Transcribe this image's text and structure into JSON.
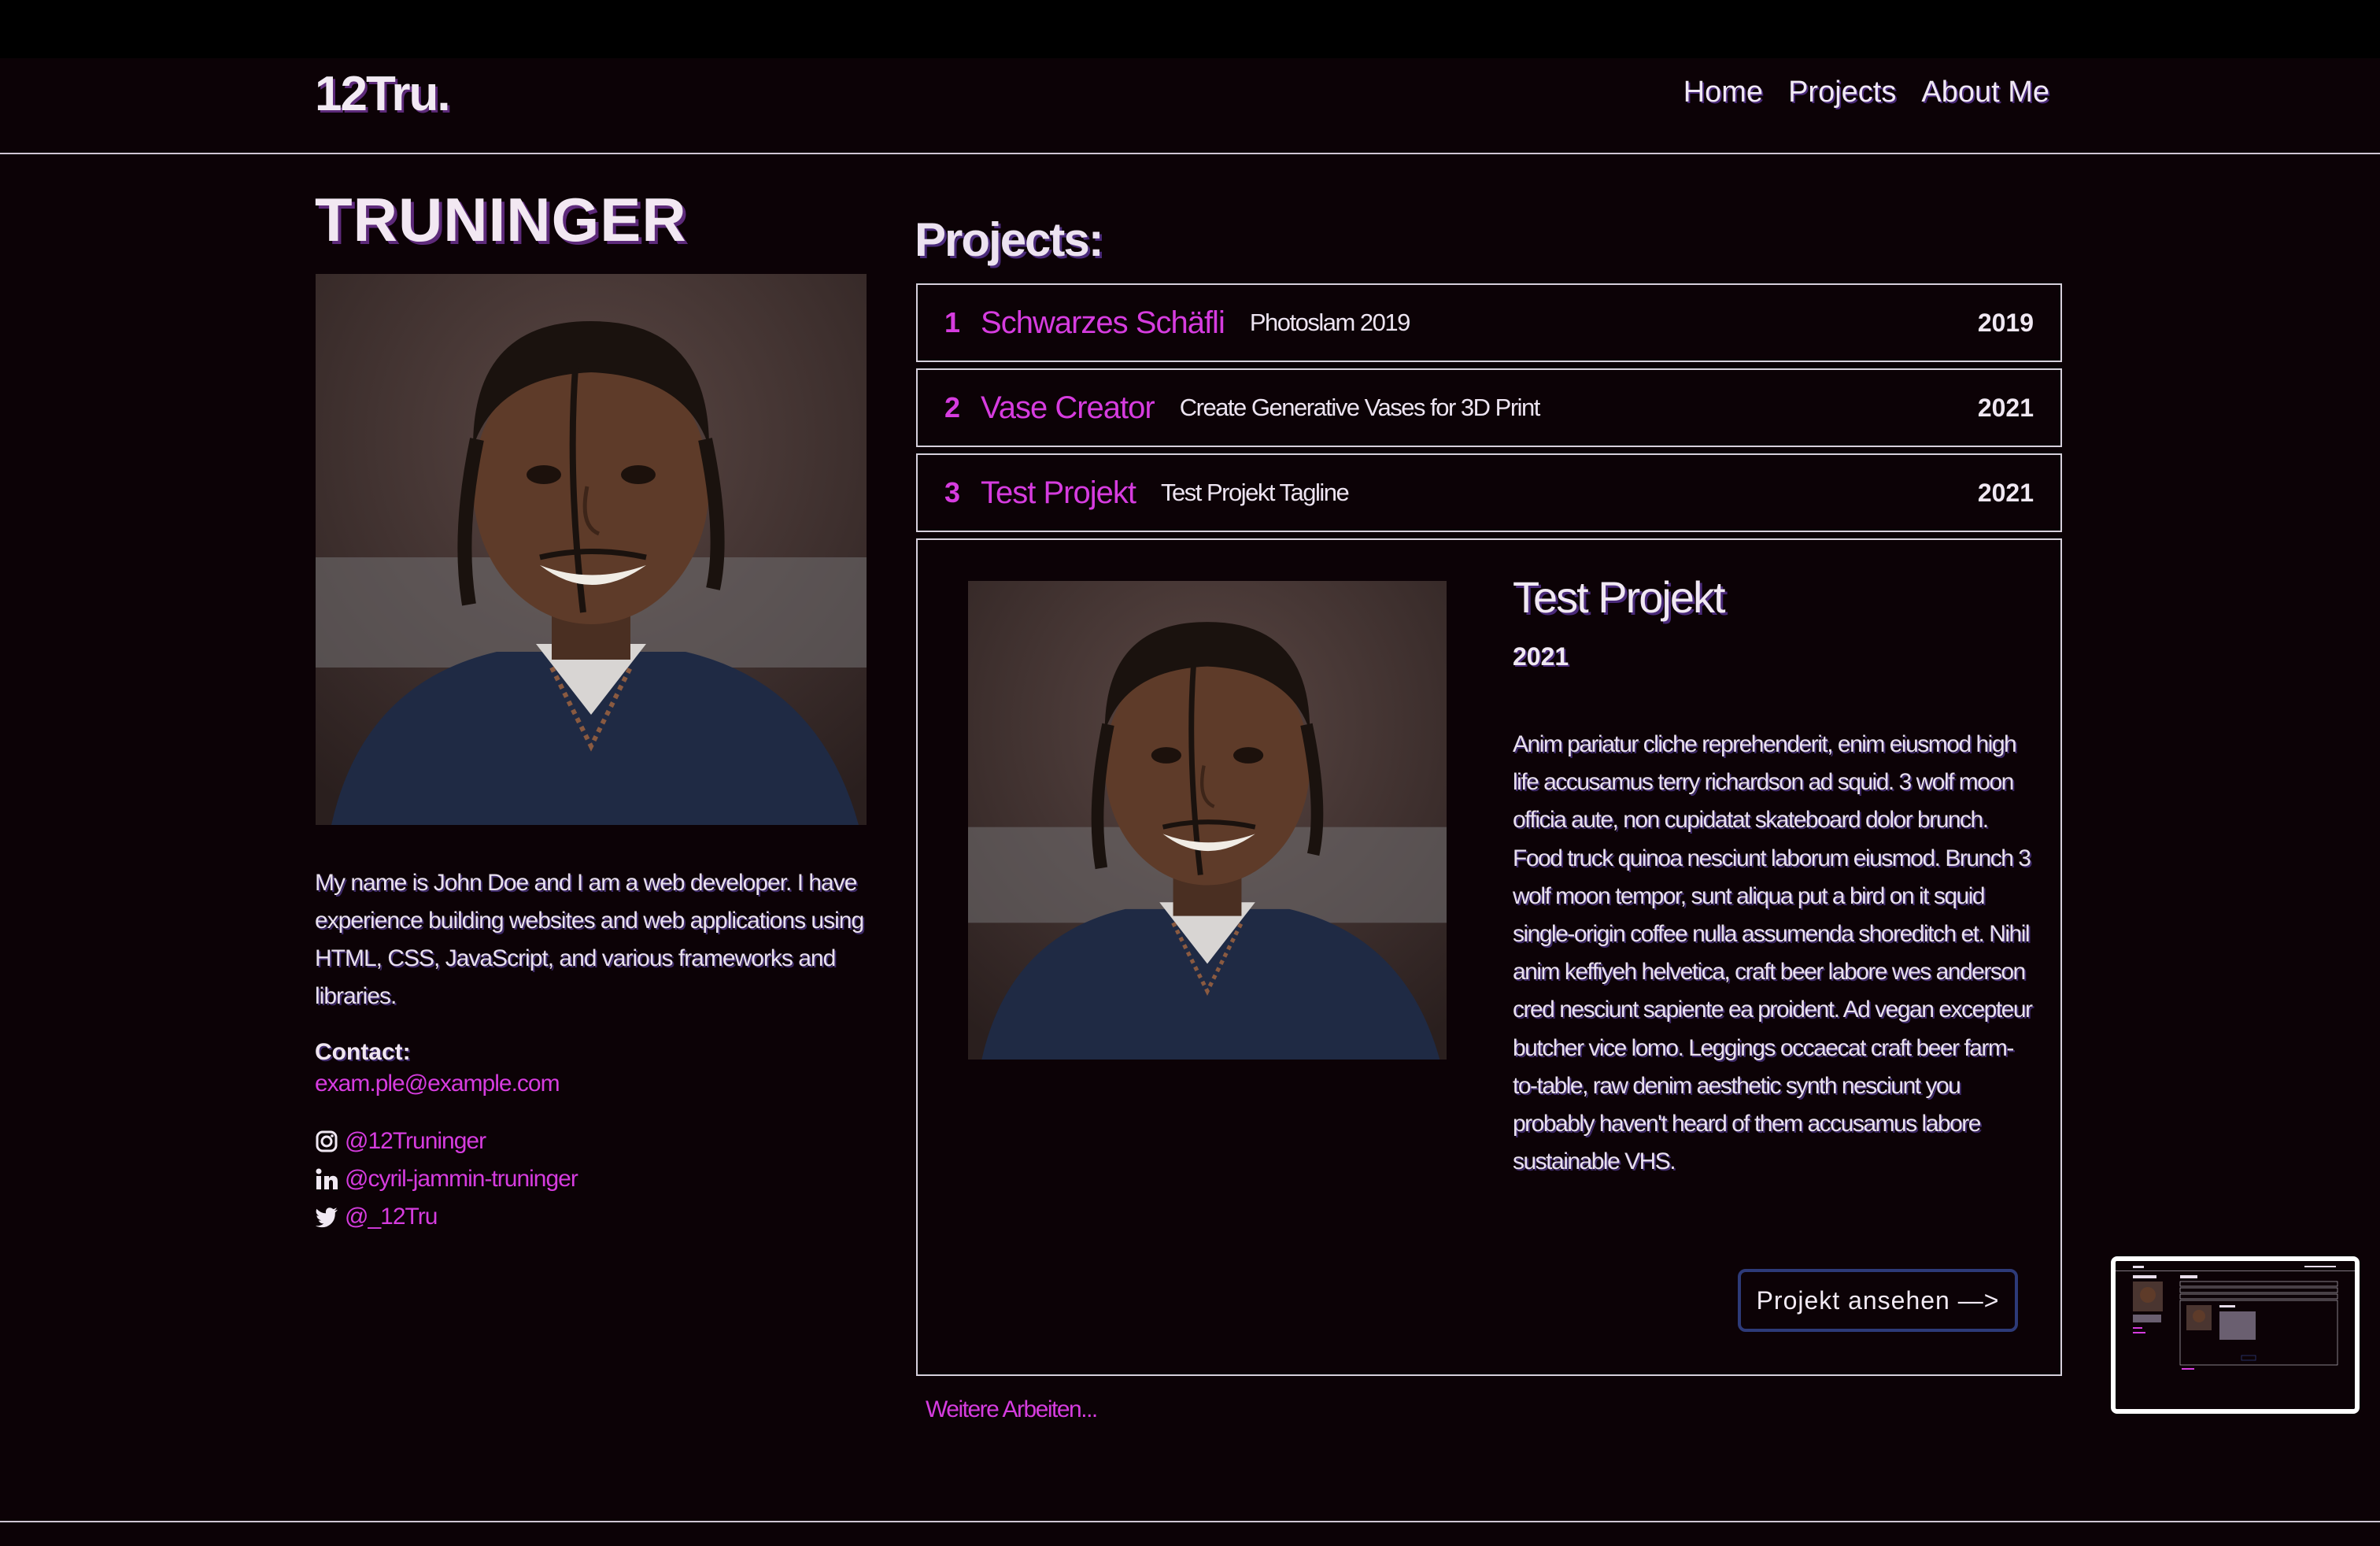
{
  "header": {
    "logo": "12Tru.",
    "nav": [
      "Home",
      "Projects",
      "About Me"
    ]
  },
  "profile": {
    "name": "TRUNINGER",
    "portrait_alt": "Portrait of a smiling man with dreadlocks",
    "bio": "My name is John Doe and I am a web developer. I have experience building websites and web applications using HTML, CSS, JavaScript, and various frameworks and libraries.",
    "contact_label": "Contact:",
    "email": "exam.ple@example.com",
    "socials": [
      {
        "icon": "instagram-icon",
        "handle": "@12Truninger"
      },
      {
        "icon": "linkedin-icon",
        "handle": "@cyril-jammin-truninger"
      },
      {
        "icon": "twitter-icon",
        "handle": "@_12Tru"
      }
    ]
  },
  "projects": {
    "heading": "Projects:",
    "items": [
      {
        "num": "1",
        "title": "Schwarzes Schäfli",
        "tagline": "Photoslam 2019",
        "year": "2019"
      },
      {
        "num": "2",
        "title": "Vase Creator",
        "tagline": "Create Generative Vases for 3D Print",
        "year": "2021"
      },
      {
        "num": "3",
        "title": "Test Projekt",
        "tagline": "Test Projekt Tagline",
        "year": "2021"
      }
    ],
    "detail": {
      "title": "Test Projekt",
      "year": "2021",
      "text": "Anim pariatur cliche reprehenderit, enim eiusmod high life accusamus terry richardson ad squid. 3 wolf moon officia aute, non cupidatat skateboard dolor brunch. Food truck quinoa nesciunt laborum eiusmod. Brunch 3 wolf moon tempor, sunt aliqua put a bird on it squid single-origin coffee nulla assumenda shoreditch et. Nihil anim keffiyeh helvetica, craft beer labore wes anderson cred nesciunt sapiente ea proident. Ad vegan excepteur butcher vice lomo. Leggings occaecat craft beer farm-to-table, raw denim aesthetic synth nesciunt you probably haven't heard of them accusamus labore sustainable VHS.",
      "button": "Projekt ansehen —>"
    },
    "more": "Weitere Arbeiten..."
  },
  "colors": {
    "background": "#0c0206",
    "accent": "#d63cdf",
    "border": "#d6d0dc",
    "button_border": "#2d3a78"
  }
}
